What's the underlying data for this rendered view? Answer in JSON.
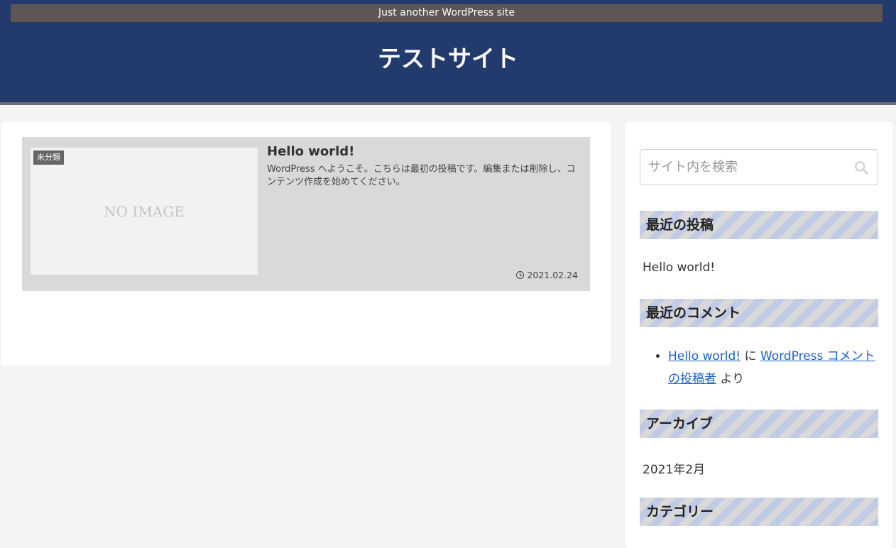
{
  "header": {
    "tagline": "Just another WordPress site",
    "site_title": "テストサイト"
  },
  "post": {
    "category": "未分類",
    "thumbnail_text": "NO IMAGE",
    "title": "Hello world!",
    "snippet": "WordPress へようこそ。こちらは最初の投稿です。編集または削除し、コンテンツ作成を始めてください。",
    "date": "2021.02.24"
  },
  "sidebar": {
    "search_placeholder": "サイト内を検索",
    "recent_posts": {
      "heading": "最近の投稿",
      "items": [
        "Hello world!"
      ]
    },
    "recent_comments": {
      "heading": "最近のコメント",
      "post_link": "Hello world!",
      "on_text": "に",
      "author_link": "WordPress コメントの投稿者",
      "by_text": "より"
    },
    "archives": {
      "heading": "アーカイブ",
      "items": [
        "2021年2月"
      ]
    },
    "categories": {
      "heading": "カテゴリー"
    }
  },
  "colors": {
    "header_bg": "#233a6c",
    "tagline_bg": "#5d5653",
    "link": "#1a60c8",
    "stripe_blue": "#c0cce6",
    "stripe_gray": "#d9d9d9"
  }
}
